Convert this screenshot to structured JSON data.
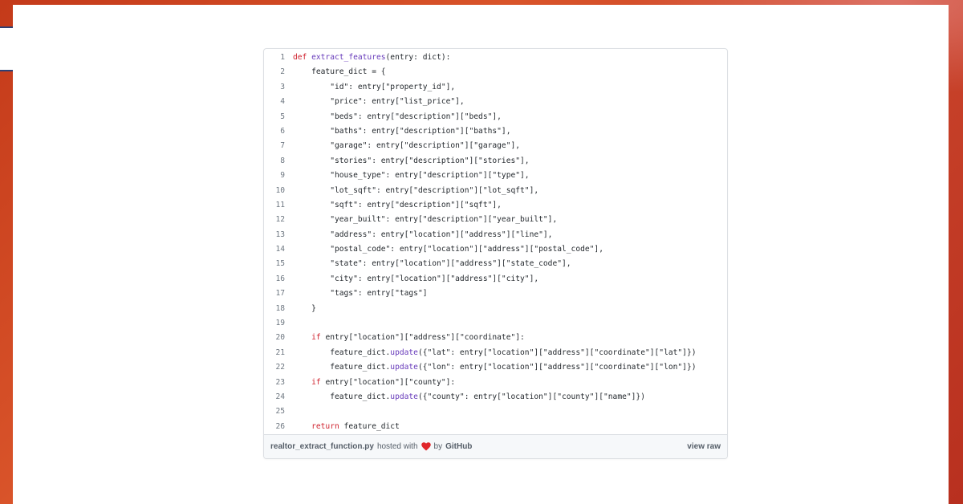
{
  "colors": {
    "background_orange": "#d9542a",
    "panel": "#ffffff",
    "keyword": "#cf222e",
    "function_name": "#6639ba",
    "heart": "#e0262b"
  },
  "code_lines": [
    {
      "n": "1",
      "text": "def extract_features(entry: dict):"
    },
    {
      "n": "2",
      "text": "    feature_dict = {"
    },
    {
      "n": "3",
      "text": "        \"id\": entry[\"property_id\"],"
    },
    {
      "n": "4",
      "text": "        \"price\": entry[\"list_price\"],"
    },
    {
      "n": "5",
      "text": "        \"beds\": entry[\"description\"][\"beds\"],"
    },
    {
      "n": "6",
      "text": "        \"baths\": entry[\"description\"][\"baths\"],"
    },
    {
      "n": "7",
      "text": "        \"garage\": entry[\"description\"][\"garage\"],"
    },
    {
      "n": "8",
      "text": "        \"stories\": entry[\"description\"][\"stories\"],"
    },
    {
      "n": "9",
      "text": "        \"house_type\": entry[\"description\"][\"type\"],"
    },
    {
      "n": "10",
      "text": "        \"lot_sqft\": entry[\"description\"][\"lot_sqft\"],"
    },
    {
      "n": "11",
      "text": "        \"sqft\": entry[\"description\"][\"sqft\"],"
    },
    {
      "n": "12",
      "text": "        \"year_built\": entry[\"description\"][\"year_built\"],"
    },
    {
      "n": "13",
      "text": "        \"address\": entry[\"location\"][\"address\"][\"line\"],"
    },
    {
      "n": "14",
      "text": "        \"postal_code\": entry[\"location\"][\"address\"][\"postal_code\"],"
    },
    {
      "n": "15",
      "text": "        \"state\": entry[\"location\"][\"address\"][\"state_code\"],"
    },
    {
      "n": "16",
      "text": "        \"city\": entry[\"location\"][\"address\"][\"city\"],"
    },
    {
      "n": "17",
      "text": "        \"tags\": entry[\"tags\"]"
    },
    {
      "n": "18",
      "text": "    }"
    },
    {
      "n": "19",
      "text": ""
    },
    {
      "n": "20",
      "text": "    if entry[\"location\"][\"address\"][\"coordinate\"]:"
    },
    {
      "n": "21",
      "text": "        feature_dict.update({\"lat\": entry[\"location\"][\"address\"][\"coordinate\"][\"lat\"]})"
    },
    {
      "n": "22",
      "text": "        feature_dict.update({\"lon\": entry[\"location\"][\"address\"][\"coordinate\"][\"lon\"]})"
    },
    {
      "n": "23",
      "text": "    if entry[\"location\"][\"county\"]:"
    },
    {
      "n": "24",
      "text": "        feature_dict.update({\"county\": entry[\"location\"][\"county\"][\"name\"]})"
    },
    {
      "n": "25",
      "text": ""
    },
    {
      "n": "26",
      "text": "    return feature_dict"
    }
  ],
  "footer": {
    "filename": "realtor_extract_function.py",
    "hosted_with": "hosted with",
    "heart_icon": "heart-icon",
    "by": "by",
    "github": "GitHub",
    "view_raw": "view raw"
  }
}
